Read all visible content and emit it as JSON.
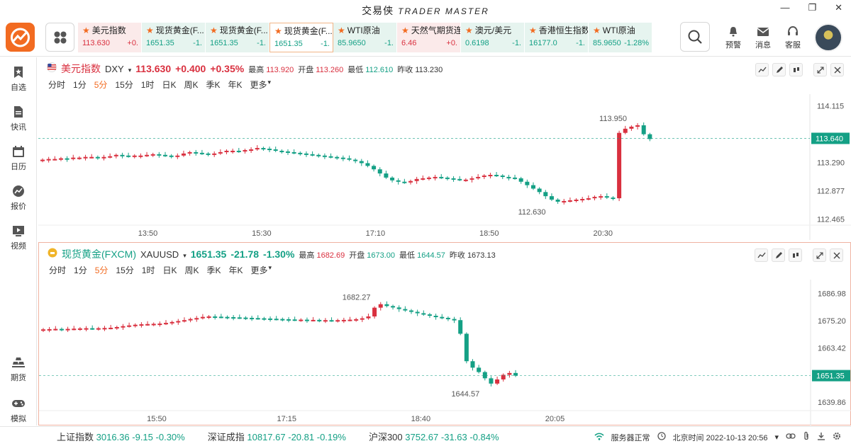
{
  "app": {
    "title": "交易侠",
    "subtitle": "TRADER MASTER"
  },
  "quotes": [
    {
      "name": "美元指数",
      "price": "113.630",
      "change": "+0.",
      "dir": "up",
      "bg": "red"
    },
    {
      "name": "现货黄金(F...",
      "price": "1651.35",
      "change": "-1.",
      "dir": "down",
      "bg": "green"
    },
    {
      "name": "现货黄金(F...",
      "price": "1651.35",
      "change": "-1.",
      "dir": "down",
      "bg": "green"
    },
    {
      "name": "现货黄金(F...",
      "price": "1651.35",
      "change": "-1.",
      "dir": "down",
      "bg": "active"
    },
    {
      "name": "WTI原油",
      "price": "85.9650",
      "change": "-1.",
      "dir": "down",
      "bg": "green"
    },
    {
      "name": "天然气期货连",
      "price": "6.46",
      "change": "+0.",
      "dir": "up",
      "bg": "red"
    },
    {
      "name": "澳元/美元",
      "price": "0.6198",
      "change": "-1.",
      "dir": "down",
      "bg": "green"
    },
    {
      "name": "香港恒生指数",
      "price": "16177.0",
      "change": "-1.",
      "dir": "down",
      "bg": "green"
    },
    {
      "name": "WTI原油",
      "price": "85.9650",
      "change": "-1.28%",
      "dir": "down",
      "bg": "green"
    }
  ],
  "topnav": {
    "alert": "预警",
    "message": "消息",
    "service": "客服"
  },
  "sidebar": {
    "items": [
      {
        "label": "自选",
        "icon": "bookmark-star-icon"
      },
      {
        "label": "快讯",
        "icon": "document-icon"
      },
      {
        "label": "日历",
        "icon": "calendar-icon"
      },
      {
        "label": "报价",
        "icon": "trend-icon"
      },
      {
        "label": "视频",
        "icon": "video-icon"
      },
      {
        "label": "期货",
        "icon": "gold-bars-icon"
      },
      {
        "label": "模拟",
        "icon": "gamepad-icon"
      }
    ]
  },
  "timeframes": [
    "分时",
    "1分",
    "5分",
    "15分",
    "1时",
    "日K",
    "周K",
    "季K",
    "年K",
    "更多"
  ],
  "active_timeframe": "5分",
  "panels": [
    {
      "name": "美元指数",
      "code": "DXY",
      "price": "113.630",
      "change": "+0.400",
      "pct": "+0.35%",
      "high_label": "最高",
      "high": "113.920",
      "open_label": "开盘",
      "open": "113.260",
      "low_label": "最低",
      "low": "112.610",
      "prev_label": "昨收",
      "prev": "113.230"
    },
    {
      "name": "现货黄金(FXCM)",
      "code": "XAUUSD",
      "price": "1651.35",
      "change": "-21.78",
      "pct": "-1.30%",
      "high_label": "最高",
      "high": "1682.69",
      "open_label": "开盘",
      "open": "1673.00",
      "low_label": "最低",
      "low": "1644.57",
      "prev_label": "昨收",
      "prev": "1673.13"
    }
  ],
  "chart_data": [
    {
      "type": "candlestick",
      "title": "美元指数 DXY",
      "x_ticks": [
        "13:50",
        "15:30",
        "17:10",
        "18:50",
        "20:30"
      ],
      "y_ticks": [
        "114.115",
        "113.290",
        "112.877",
        "112.465"
      ],
      "ylim": [
        112.39,
        114.2
      ],
      "current_price": "113.640",
      "high_annotation": "113.950",
      "low_annotation": "112.630",
      "series": [
        {
          "name": "DXY",
          "closes": [
            113.33,
            113.34,
            113.34,
            113.35,
            113.34,
            113.36,
            113.36,
            113.37,
            113.37,
            113.36,
            113.37,
            113.38,
            113.4,
            113.39,
            113.38,
            113.39,
            113.39,
            113.4,
            113.41,
            113.4,
            113.39,
            113.38,
            113.39,
            113.42,
            113.44,
            113.43,
            113.42,
            113.41,
            113.42,
            113.44,
            113.46,
            113.46,
            113.45,
            113.47,
            113.48,
            113.5,
            113.49,
            113.48,
            113.46,
            113.45,
            113.44,
            113.43,
            113.42,
            113.41,
            113.4,
            113.39,
            113.38,
            113.37,
            113.36,
            113.35,
            113.33,
            113.31,
            113.28,
            113.24,
            113.19,
            113.13,
            113.07,
            113.03,
            113.01,
            113.0,
            113.02,
            113.05,
            113.06,
            113.07,
            113.08,
            113.07,
            113.06,
            113.05,
            113.04,
            113.04,
            113.06,
            113.08,
            113.1,
            113.11,
            113.1,
            113.08,
            113.07,
            113.06,
            113.01,
            112.96,
            112.91,
            112.86,
            112.8,
            112.75,
            112.72,
            112.73,
            112.74,
            112.75,
            112.76,
            112.77,
            112.79,
            112.8,
            112.78,
            112.77,
            113.72,
            113.78,
            113.81,
            113.83,
            113.7,
            113.63
          ]
        }
      ]
    },
    {
      "type": "candlestick",
      "title": "现货黄金(FXCM) XAUUSD",
      "x_ticks": [
        "15:50",
        "17:15",
        "18:40",
        "20:05"
      ],
      "y_ticks": [
        "1686.98",
        "1675.20",
        "1663.42",
        "1651.35",
        "1639.86"
      ],
      "ylim": [
        1636.5,
        1690.5
      ],
      "current_price": "1651.35",
      "high_annotation": "1682.27",
      "low_annotation": "1644.57",
      "series": [
        {
          "name": "XAUUSD",
          "closes": [
            1671.4,
            1671.5,
            1671.6,
            1671.5,
            1671.6,
            1671.7,
            1671.8,
            1671.9,
            1671.8,
            1671.9,
            1672.0,
            1672.1,
            1672.4,
            1672.8,
            1673.1,
            1673.4,
            1673.6,
            1673.7,
            1673.8,
            1673.9,
            1674.2,
            1674.6,
            1675.0,
            1675.4,
            1675.9,
            1676.3,
            1676.8,
            1677.0,
            1676.9,
            1676.8,
            1676.7,
            1676.6,
            1676.5,
            1676.4,
            1676.3,
            1676.2,
            1676.1,
            1676.0,
            1675.9,
            1675.8,
            1675.7,
            1675.6,
            1675.6,
            1675.5,
            1675.5,
            1675.4,
            1675.4,
            1675.3,
            1675.4,
            1675.5,
            1675.6,
            1675.8,
            1676.2,
            1677.0,
            1680.8,
            1682.3,
            1681.5,
            1680.9,
            1680.2,
            1679.6,
            1679.0,
            1678.4,
            1677.9,
            1677.3,
            1676.8,
            1676.4,
            1675.9,
            1675.4,
            1669.5,
            1657.6,
            1654.8,
            1652.9,
            1650.2,
            1647.9,
            1649.7,
            1651.7,
            1652.5,
            1651.35
          ]
        }
      ]
    }
  ],
  "bottom": {
    "indices": [
      {
        "name": "上证指数",
        "value": "3016.36",
        "change": "-9.15",
        "pct": "-0.30%"
      },
      {
        "name": "深证成指",
        "value": "10817.67",
        "change": "-20.81",
        "pct": "-0.19%"
      },
      {
        "name": "沪深300",
        "value": "3752.67",
        "change": "-31.63",
        "pct": "-0.84%"
      }
    ],
    "server_status": "服务器正常",
    "clock": "北京时间 2022-10-13 20:56"
  },
  "colors": {
    "up": "#d9303f",
    "down": "#14a085",
    "accent": "#f26b21"
  }
}
